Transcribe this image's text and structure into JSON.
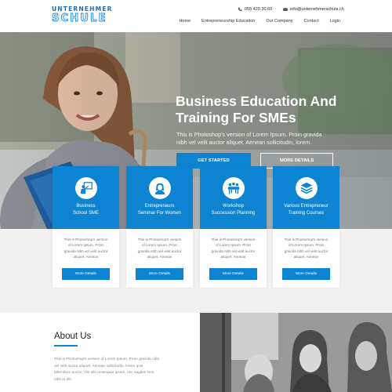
{
  "brand": {
    "logo_top": "UNTERNEHMER",
    "logo_bottom": "SCHULE"
  },
  "contact": {
    "phone": "055 420 30 60",
    "email": "info@unternehmerschule.ch"
  },
  "nav": {
    "items": [
      "Home",
      "Entrepreneurship Education",
      "Our Company",
      "Contact",
      "Login"
    ]
  },
  "hero": {
    "title_lines": [
      "Business Education And",
      "Training For SMEs"
    ],
    "subtitle_lines": [
      "This is Photoshop's version  of Lorem Ipsum. Proin gravida",
      "nibh vel velit auctor aliquet. Aenean sollicitudin, lorem."
    ],
    "primary_button": "GET STARTED",
    "secondary_button": "MORE DETAILS"
  },
  "cards": [
    {
      "icon": "teacher-board-icon",
      "title_lines": [
        "Business",
        "School SME"
      ],
      "text_lines": [
        "This is Photoshop's version",
        "of Lorem Ipsum. Proin",
        "gravida nibh vel velit auctor",
        "aliquet. Aenean"
      ],
      "button": "More Details"
    },
    {
      "icon": "woman-avatar-icon",
      "title_lines": [
        "Entrepreneurs",
        "Seminar For Women"
      ],
      "text_lines": [
        "This is Photoshop's version",
        "of Lorem Ipsum. Proin",
        "gravida nibh vel velit auctor",
        "aliquet. Aenean"
      ],
      "button": "More Details"
    },
    {
      "icon": "team-meeting-icon",
      "title_lines": [
        "Workshop",
        "Succession Planning"
      ],
      "text_lines": [
        "This is Photoshop's version",
        "of Lorem Ipsum. Proin",
        "gravida nibh vel velit auctor",
        "aliquet. Aenean"
      ],
      "button": "More Details"
    },
    {
      "icon": "layers-stack-icon",
      "title_lines": [
        "Various Entrepreneur",
        "Training Courses"
      ],
      "text_lines": [
        "This is Photoshop's version",
        "of Lorem Ipsum. Proin",
        "gravida nibh vel velit auctor",
        "aliquet. Aenean"
      ],
      "button": "More Details"
    }
  ],
  "about": {
    "title": "About Us",
    "text_lines": [
      "This is Photoshop's version  of Lorem Ipsum. Proin gravida nibh",
      "vel velit auctor aliquet. Aenean sollicitudin, lorem quis",
      "bibendum auctor, nisi elit consequat ipsum, nec sagittis sem",
      "nibh id elit."
    ]
  },
  "colors": {
    "accent": "#0d84d1",
    "band": "#f1f1f1",
    "logo_blue": "#1b6fb8"
  }
}
